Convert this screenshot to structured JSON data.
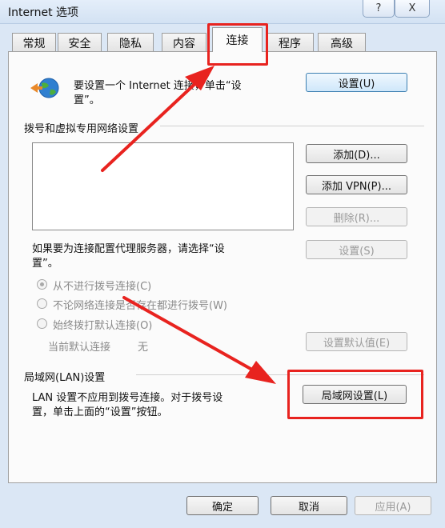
{
  "window": {
    "title": "Internet 选项",
    "help_label": "?",
    "close_label": "X"
  },
  "tabs": [
    {
      "label": "常规"
    },
    {
      "label": "安全"
    },
    {
      "label": "隐私"
    },
    {
      "label": "内容"
    },
    {
      "label": "连接"
    },
    {
      "label": "程序"
    },
    {
      "label": "高级"
    }
  ],
  "active_tab": "连接",
  "setup": {
    "text_line1": "要设置一个 Internet 连接，单击“设",
    "text_line2": "置”。",
    "button": "设置(U)"
  },
  "dialup": {
    "group_label": "拨号和虚拟专用网络设置",
    "connections": [],
    "add_button": "添加(D)...",
    "add_vpn_button": "添加 VPN(P)...",
    "remove_button": "删除(R)...",
    "proxy_text_line1": "如果要为连接配置代理服务器，请选择“设",
    "proxy_text_line2": "置”。",
    "settings_button": "设置(S)",
    "radio_options": [
      {
        "label": "从不进行拨号连接(C)",
        "selected": true
      },
      {
        "label": "不论网络连接是否存在都进行拨号(W)",
        "selected": false
      },
      {
        "label": "始终拨打默认连接(O)",
        "selected": false
      }
    ],
    "current_default_label": "当前默认连接",
    "current_default_value": "无",
    "set_default_button": "设置默认值(E)"
  },
  "lan": {
    "group_label": "局域网(LAN)设置",
    "text_line1": "LAN 设置不应用到拨号连接。对于拨号设",
    "text_line2": "置，单击上面的“设置”按钮。",
    "button": "局域网设置(L)"
  },
  "footer": {
    "ok_button": "确定",
    "cancel_button": "取消",
    "apply_button": "应用(A)"
  },
  "annotation_color": "#e8231f"
}
